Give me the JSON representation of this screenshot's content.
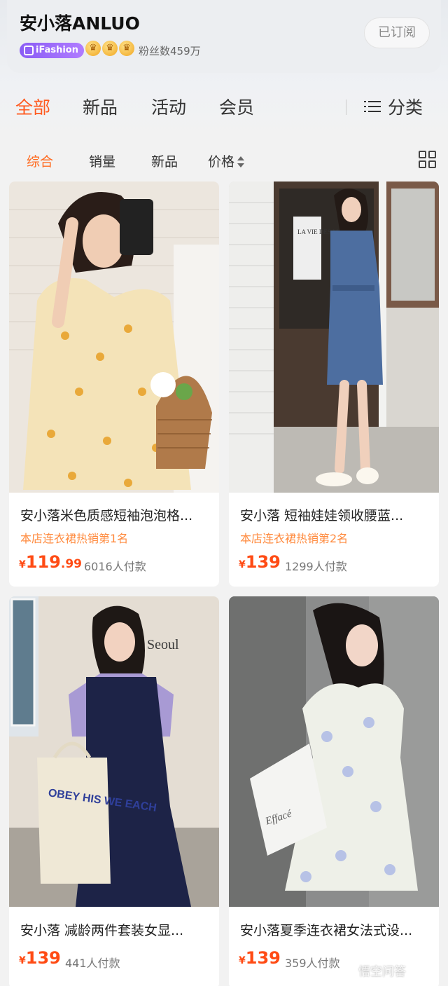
{
  "shop": {
    "name": "安小落ANLUO",
    "badge": "iFashion",
    "fans": "粉丝数459万",
    "subscribe_label": "已订阅"
  },
  "tabs": [
    "全部",
    "新品",
    "活动",
    "会员"
  ],
  "category_label": "分类",
  "sort": [
    "综合",
    "销量",
    "新品",
    "价格"
  ],
  "products": [
    {
      "title": "安小落米色质感短袖泡泡格...",
      "rank": "本店连衣裙热销第1名",
      "currency": "¥",
      "price_int": "119",
      "price_dec": ".99",
      "sold": "6016人付款"
    },
    {
      "title": "安小落 短袖娃娃领收腰蓝...",
      "rank": "本店连衣裙热销第2名",
      "currency": "¥",
      "price_int": "139",
      "price_dec": "",
      "sold": "1299人付款"
    },
    {
      "title": "安小落 减龄两件套装女显...",
      "rank": "",
      "currency": "¥",
      "price_int": "139",
      "price_dec": "",
      "sold": "441人付款"
    },
    {
      "title": "安小落夏季连衣裙女法式设...",
      "rank": "",
      "currency": "¥",
      "price_int": "139",
      "price_dec": "",
      "sold": "359人付款"
    }
  ],
  "photo_text": {
    "cafe_sign": "LA VIE DES MA",
    "wall_sign": "Seoul",
    "bag1": "OBEY HIS WE EACH",
    "bag2": "Effacé"
  },
  "watermark": "悟空问答",
  "colors": {
    "accent": "#ff5a1f",
    "price": "#ff4b14",
    "rank": "#ff8a3d",
    "badge": "#8a5cf5"
  }
}
